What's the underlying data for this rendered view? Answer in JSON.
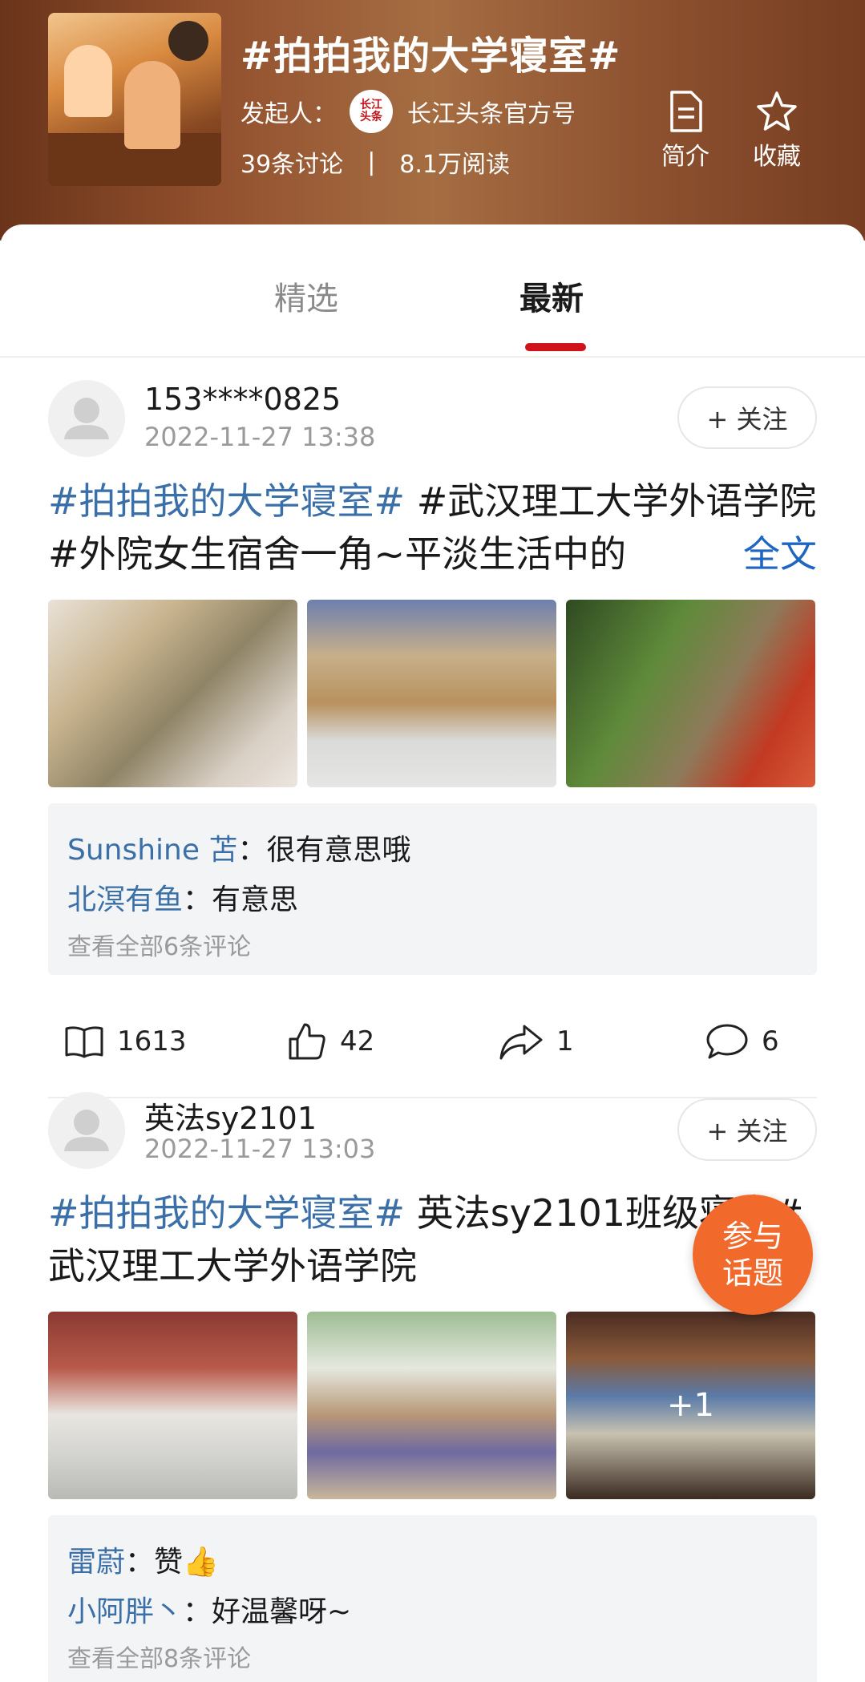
{
  "header": {
    "title": "#拍拍我的大学寝室#",
    "sponsor_label": "发起人：",
    "sponsor_name": "长江头条官方号",
    "discussions": "39条讨论",
    "separator": "|",
    "reads": "8.1万阅读",
    "intro_label": "简介",
    "favorite_label": "收藏"
  },
  "tabs": [
    {
      "label": "精选",
      "active": false
    },
    {
      "label": "最新",
      "active": true
    }
  ],
  "posts": [
    {
      "username": "153****0825",
      "time": "2022-11-27 13:38",
      "follow_label": "+ 关注",
      "tag": "#拍拍我的大学寝室#",
      "text": " #武汉理工大学外语学院#外院女生宿舍一角~平淡生活中的",
      "fulltext_label": "全文",
      "comments": [
        {
          "user": "Sunshine 苫",
          "sep": "：",
          "text": "很有意思哦"
        },
        {
          "user": "北溟有鱼",
          "sep": "：",
          "text": "有意思"
        }
      ],
      "view_all": "查看全部6条评论",
      "reads": "1613",
      "likes": "42",
      "shares": "1",
      "comment_count": "6"
    },
    {
      "username": "英法sy2101",
      "time": "2022-11-27 13:03",
      "follow_label": "+ 关注",
      "tag": "#拍拍我的大学寝室#",
      "text": " 英法sy2101班级寝室#武汉理工大学外语学院",
      "more_photos": "+1",
      "comments": [
        {
          "user": "雷蔚",
          "sep": "：",
          "text": "赞👍"
        },
        {
          "user": "小阿胖丶",
          "sep": "：",
          "text": "好温馨呀~"
        }
      ],
      "view_all": "查看全部8条评论"
    }
  ],
  "join_button": {
    "line1": "参与",
    "line2": "话题"
  },
  "colors": {
    "accent": "#d0121b",
    "tag": "#3b6fa8",
    "link": "#1f66c2",
    "join": "#f26a2b"
  }
}
